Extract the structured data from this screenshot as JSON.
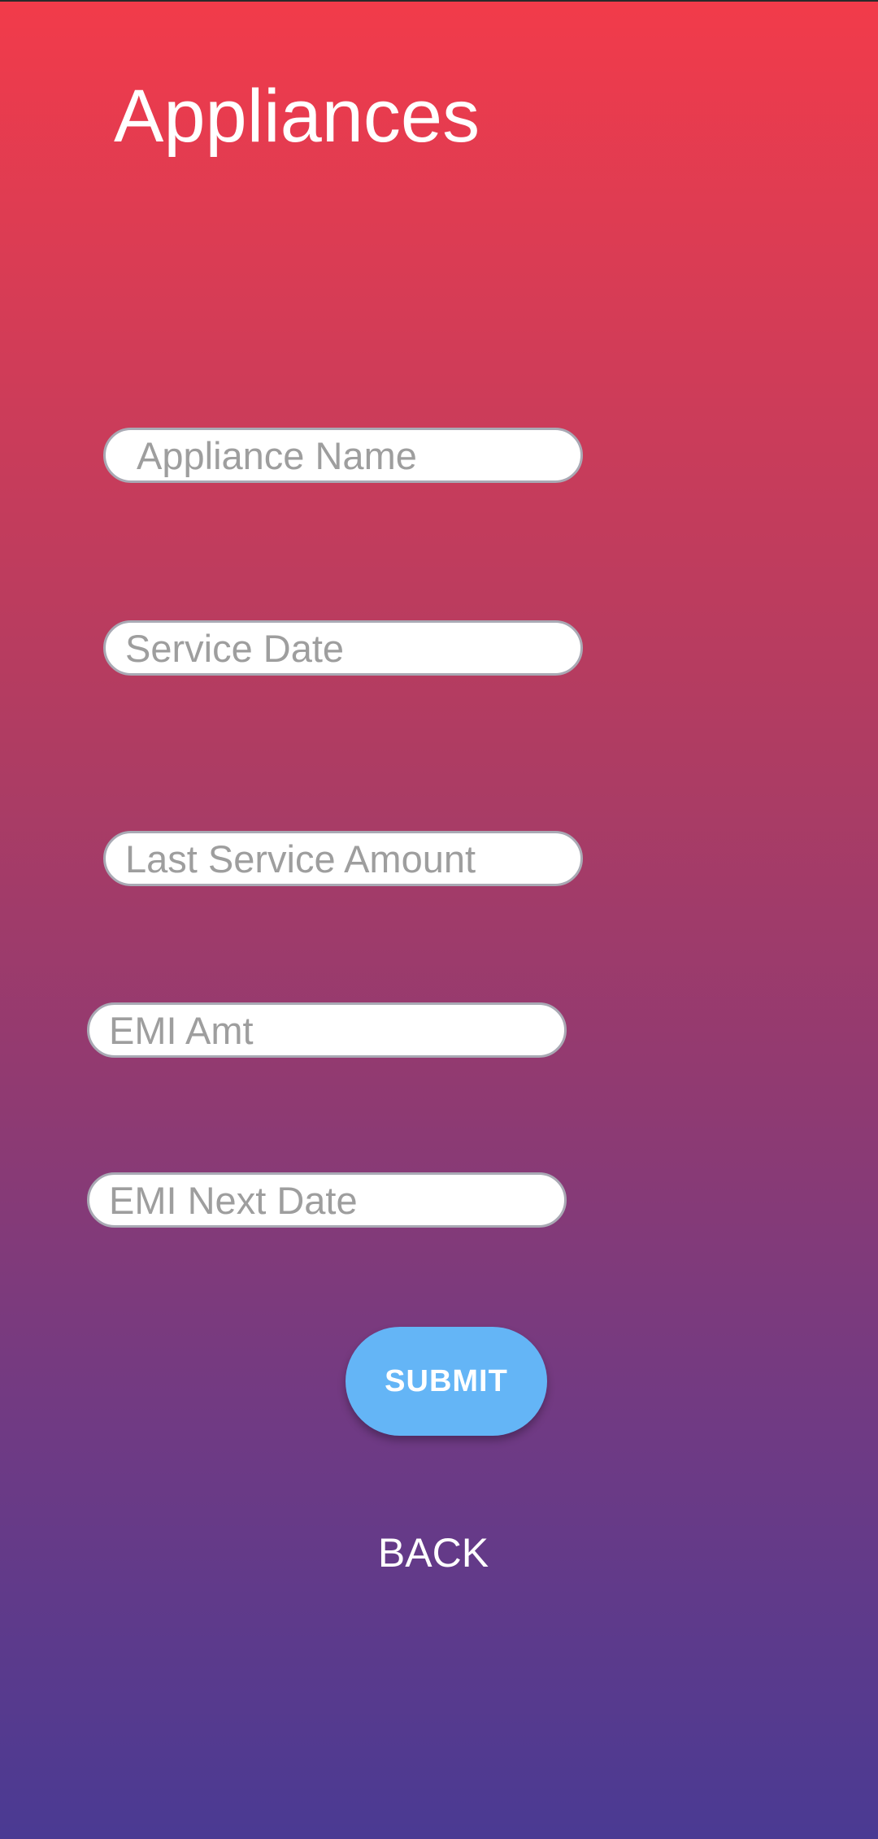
{
  "screen": {
    "title": "Appliances"
  },
  "form": {
    "fields": [
      {
        "placeholder": "Appliance Name",
        "value": ""
      },
      {
        "placeholder": "Service Date",
        "value": ""
      },
      {
        "placeholder": "Last Service Amount",
        "value": ""
      },
      {
        "placeholder": "EMI Amt",
        "value": ""
      },
      {
        "placeholder": "EMI Next Date",
        "value": ""
      }
    ],
    "submit_label": "SUBMIT",
    "back_label": "BACK"
  },
  "colors": {
    "gradient_top": "#f23b4a",
    "gradient_bottom": "#4a3a93",
    "submit_button": "#64b5f6",
    "field_border": "#a9a9b4"
  }
}
